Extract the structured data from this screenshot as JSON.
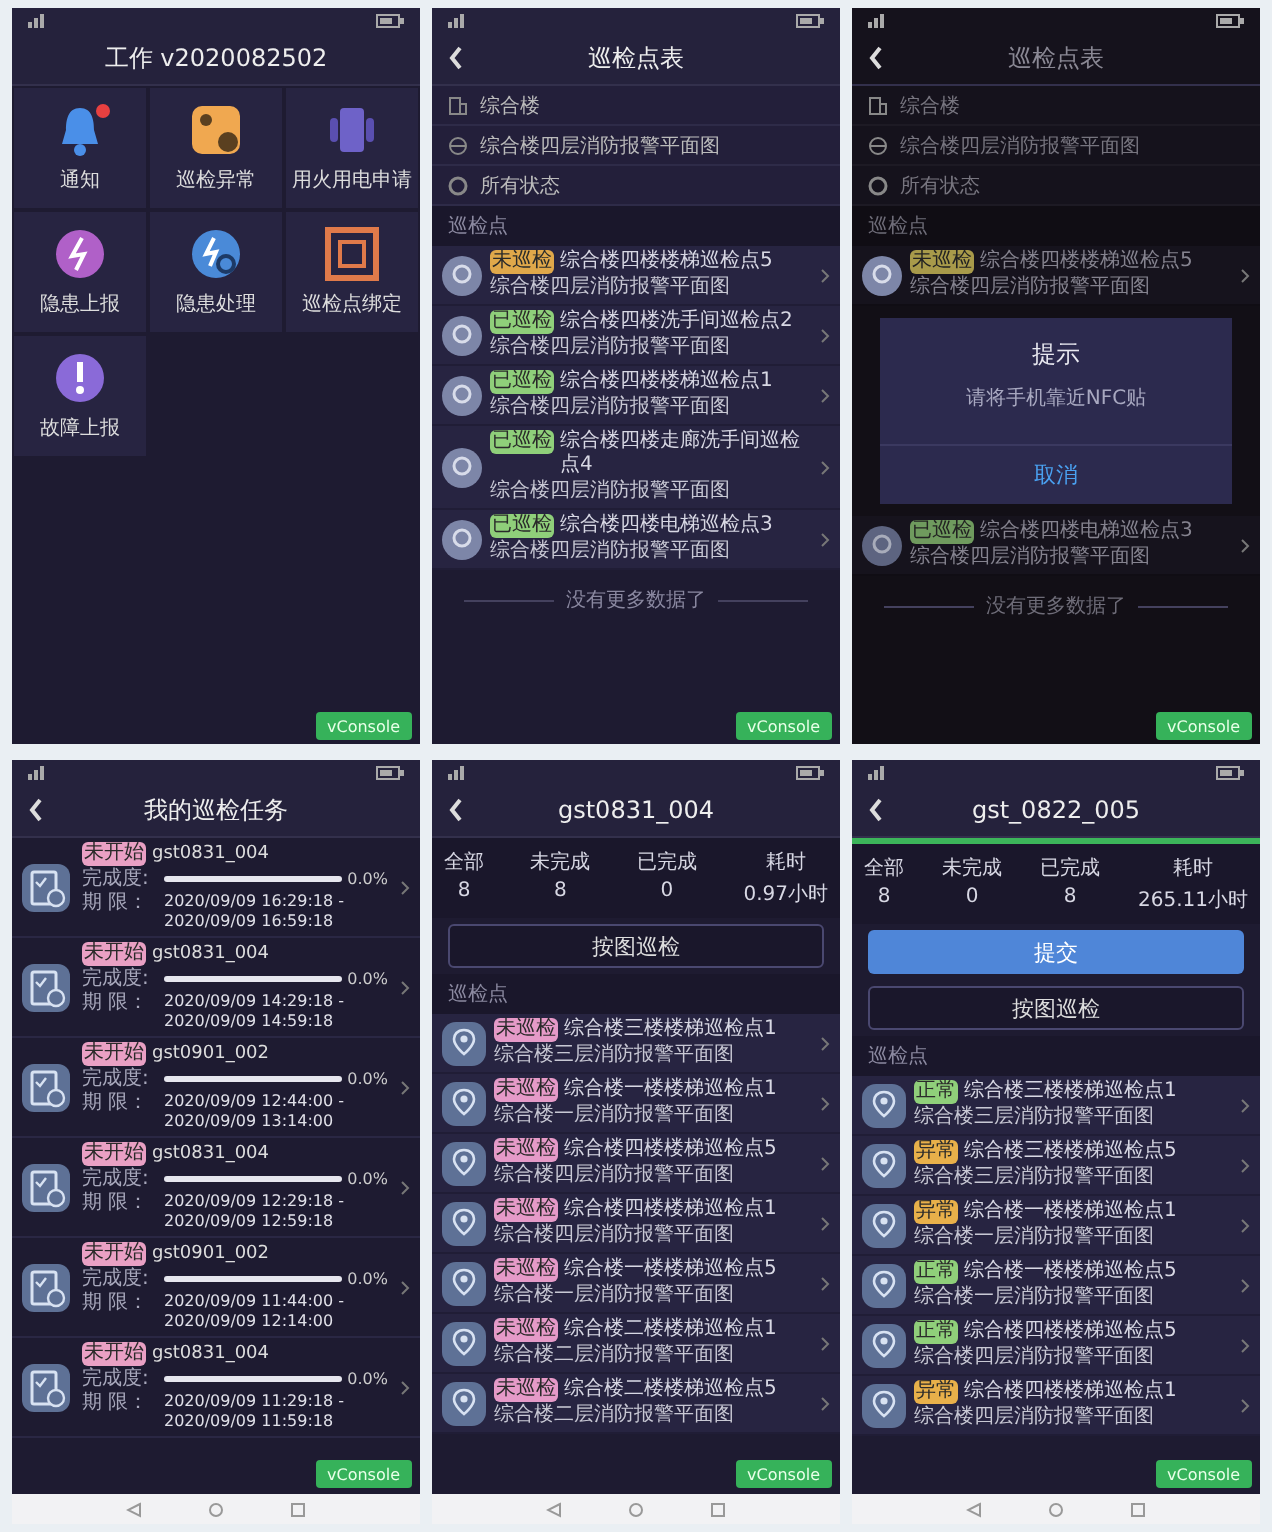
{
  "screens": [
    {
      "kind": "menu",
      "title": "工作 v2020082502",
      "tiles": [
        {
          "kind": "bell",
          "label": "通知",
          "badge": true
        },
        {
          "kind": "route",
          "label": "巡检异常",
          "badge": false
        },
        {
          "kind": "power",
          "label": "用火用电申请",
          "badge": false
        },
        {
          "kind": "report",
          "label": "隐患上报",
          "badge": false
        },
        {
          "kind": "handle",
          "label": "隐患处理",
          "badge": false
        },
        {
          "kind": "nfc",
          "label": "巡检点绑定",
          "badge": false
        },
        {
          "kind": "fault",
          "label": "故障上报",
          "badge": false
        }
      ],
      "console": "vConsole"
    },
    {
      "kind": "points",
      "back": true,
      "title": "巡检点表",
      "filters": [
        {
          "kind": "building",
          "label": "综合楼"
        },
        {
          "kind": "map",
          "label": "综合楼四层消防报警平面图"
        },
        {
          "kind": "state",
          "label": "所有状态"
        }
      ],
      "section": "巡检点",
      "items": [
        {
          "tag": "未巡检",
          "color": "#e0a84a",
          "name": "综合楼四楼楼梯巡检点5",
          "map": "综合楼四层消防报警平面图"
        },
        {
          "tag": "已巡检",
          "color": "#8fcf7a",
          "name": "综合楼四楼洗手间巡检点2",
          "map": "综合楼四层消防报警平面图"
        },
        {
          "tag": "已巡检",
          "color": "#8fcf7a",
          "name": "综合楼四楼楼梯巡检点1",
          "map": "综合楼四层消防报警平面图"
        },
        {
          "tag": "已巡检",
          "color": "#8fcf7a",
          "name": "综合楼四楼走廊洗手间巡检点4",
          "map": "综合楼四层消防报警平面图"
        },
        {
          "tag": "已巡检",
          "color": "#8fcf7a",
          "name": "综合楼四楼电梯巡检点3",
          "map": "综合楼四层消防报警平面图"
        }
      ],
      "footer": "没有更多数据了",
      "console": "vConsole"
    },
    {
      "kind": "points",
      "back": true,
      "title": "巡检点表",
      "filters": [
        {
          "kind": "building",
          "label": "综合楼"
        },
        {
          "kind": "map",
          "label": "综合楼四层消防报警平面图"
        },
        {
          "kind": "state",
          "label": "所有状态"
        }
      ],
      "section": "巡检点",
      "items": [
        {
          "tag": "未巡检",
          "color": "#a89a4a",
          "name": "综合楼四楼楼梯巡检点5",
          "map": "综合楼四层消防报警平面图"
        }
      ],
      "dialog": {
        "title": "提示",
        "message": "请将手机靠近NFC贴",
        "action": "取消"
      },
      "items_below": [
        {
          "tag": "已巡检",
          "color": "#6f9a5e",
          "name": "综合楼四楼电梯巡检点3",
          "map": "综合楼四层消防报警平面图"
        }
      ],
      "footer": "没有更多数据了",
      "console": "vConsole"
    },
    {
      "kind": "tasks",
      "back": true,
      "title": "我的巡检任务",
      "tasks": [
        {
          "tag": "未开始",
          "name": "gst0831_004",
          "progress_label": "完成度:",
          "level": 0,
          "percent": "0.0%",
          "period_label": "期 限：",
          "start": "2020/09/09 16:29:18 -",
          "end": "2020/09/09 16:59:18"
        },
        {
          "tag": "未开始",
          "name": "gst0831_004",
          "progress_label": "完成度:",
          "level": 0,
          "percent": "0.0%",
          "period_label": "期 限：",
          "start": "2020/09/09 14:29:18 -",
          "end": "2020/09/09 14:59:18"
        },
        {
          "tag": "未开始",
          "name": "gst0901_002",
          "progress_label": "完成度:",
          "level": 0,
          "percent": "0.0%",
          "period_label": "期 限：",
          "start": "2020/09/09 12:44:00 -",
          "end": "2020/09/09 13:14:00"
        },
        {
          "tag": "未开始",
          "name": "gst0831_004",
          "progress_label": "完成度:",
          "level": 0,
          "percent": "0.0%",
          "period_label": "期 限：",
          "start": "2020/09/09 12:29:18 -",
          "end": "2020/09/09 12:59:18"
        },
        {
          "tag": "未开始",
          "name": "gst0901_002",
          "progress_label": "完成度:",
          "level": 0,
          "percent": "0.0%",
          "period_label": "期 限：",
          "start": "2020/09/09 11:44:00 -",
          "end": "2020/09/09 12:14:00"
        },
        {
          "tag": "未开始",
          "name": "gst0831_004",
          "progress_label": "完成度:",
          "level": 0,
          "percent": "0.0%",
          "period_label": "期 限：",
          "start": "2020/09/09 11:29:18 -",
          "end": "2020/09/09 11:59:18"
        }
      ],
      "console": "vConsole",
      "nav_bar": true
    },
    {
      "kind": "detail",
      "back": true,
      "title": "gst0831_004",
      "stats": [
        {
          "label": "全部",
          "value": "8"
        },
        {
          "label": "未完成",
          "value": "8"
        },
        {
          "label": "已完成",
          "value": "0"
        },
        {
          "label": "耗时",
          "value": "0.97小时"
        }
      ],
      "buttons": [
        {
          "kind": "outline",
          "label": "按图巡检"
        }
      ],
      "section": "巡检点",
      "items": [
        {
          "tag": "未巡检",
          "color": "#e59ac8",
          "name": "综合楼三楼楼梯巡检点1",
          "map": "综合楼三层消防报警平面图"
        },
        {
          "tag": "未巡检",
          "color": "#e59ac8",
          "name": "综合楼一楼楼梯巡检点1",
          "map": "综合楼一层消防报警平面图"
        },
        {
          "tag": "未巡检",
          "color": "#e59ac8",
          "name": "综合楼四楼楼梯巡检点5",
          "map": "综合楼四层消防报警平面图"
        },
        {
          "tag": "未巡检",
          "color": "#e59ac8",
          "name": "综合楼四楼楼梯巡检点1",
          "map": "综合楼四层消防报警平面图"
        },
        {
          "tag": "未巡检",
          "color": "#e59ac8",
          "name": "综合楼一楼楼梯巡检点5",
          "map": "综合楼一层消防报警平面图"
        },
        {
          "tag": "未巡检",
          "color": "#e59ac8",
          "name": "综合楼二楼楼梯巡检点1",
          "map": "综合楼二层消防报警平面图"
        },
        {
          "tag": "未巡检",
          "color": "#e59ac8",
          "name": "综合楼二楼楼梯巡检点5",
          "map": "综合楼二层消防报警平面图"
        }
      ],
      "console": "vConsole",
      "nav_bar": true
    },
    {
      "kind": "detail",
      "back": true,
      "title": "gst_0822_005",
      "progress": {
        "level": 1
      },
      "stats": [
        {
          "label": "全部",
          "value": "8"
        },
        {
          "label": "未完成",
          "value": "0"
        },
        {
          "label": "已完成",
          "value": "8"
        },
        {
          "label": "耗时",
          "value": "265.11小时"
        }
      ],
      "buttons": [
        {
          "kind": "primary",
          "label": "提交"
        },
        {
          "kind": "outline",
          "label": "按图巡检"
        }
      ],
      "section": "巡检点",
      "items": [
        {
          "tag": "正常",
          "color": "#8fcf7a",
          "name": "综合楼三楼楼梯巡检点1",
          "map": "综合楼三层消防报警平面图"
        },
        {
          "tag": "异常",
          "color": "#e8b04a",
          "name": "综合楼三楼楼梯巡检点5",
          "map": "综合楼三层消防报警平面图"
        },
        {
          "tag": "异常",
          "color": "#e8b04a",
          "name": "综合楼一楼楼梯巡检点1",
          "map": "综合楼一层消防报警平面图"
        },
        {
          "tag": "正常",
          "color": "#8fcf7a",
          "name": "综合楼一楼楼梯巡检点5",
          "map": "综合楼一层消防报警平面图"
        },
        {
          "tag": "正常",
          "color": "#8fcf7a",
          "name": "综合楼四楼楼梯巡检点5",
          "map": "综合楼四层消防报警平面图"
        },
        {
          "tag": "异常",
          "color": "#e8b04a",
          "name": "综合楼四楼楼梯巡检点1",
          "map": "综合楼四层消防报警平面图"
        }
      ],
      "console": "vConsole",
      "nav_bar": true
    }
  ]
}
